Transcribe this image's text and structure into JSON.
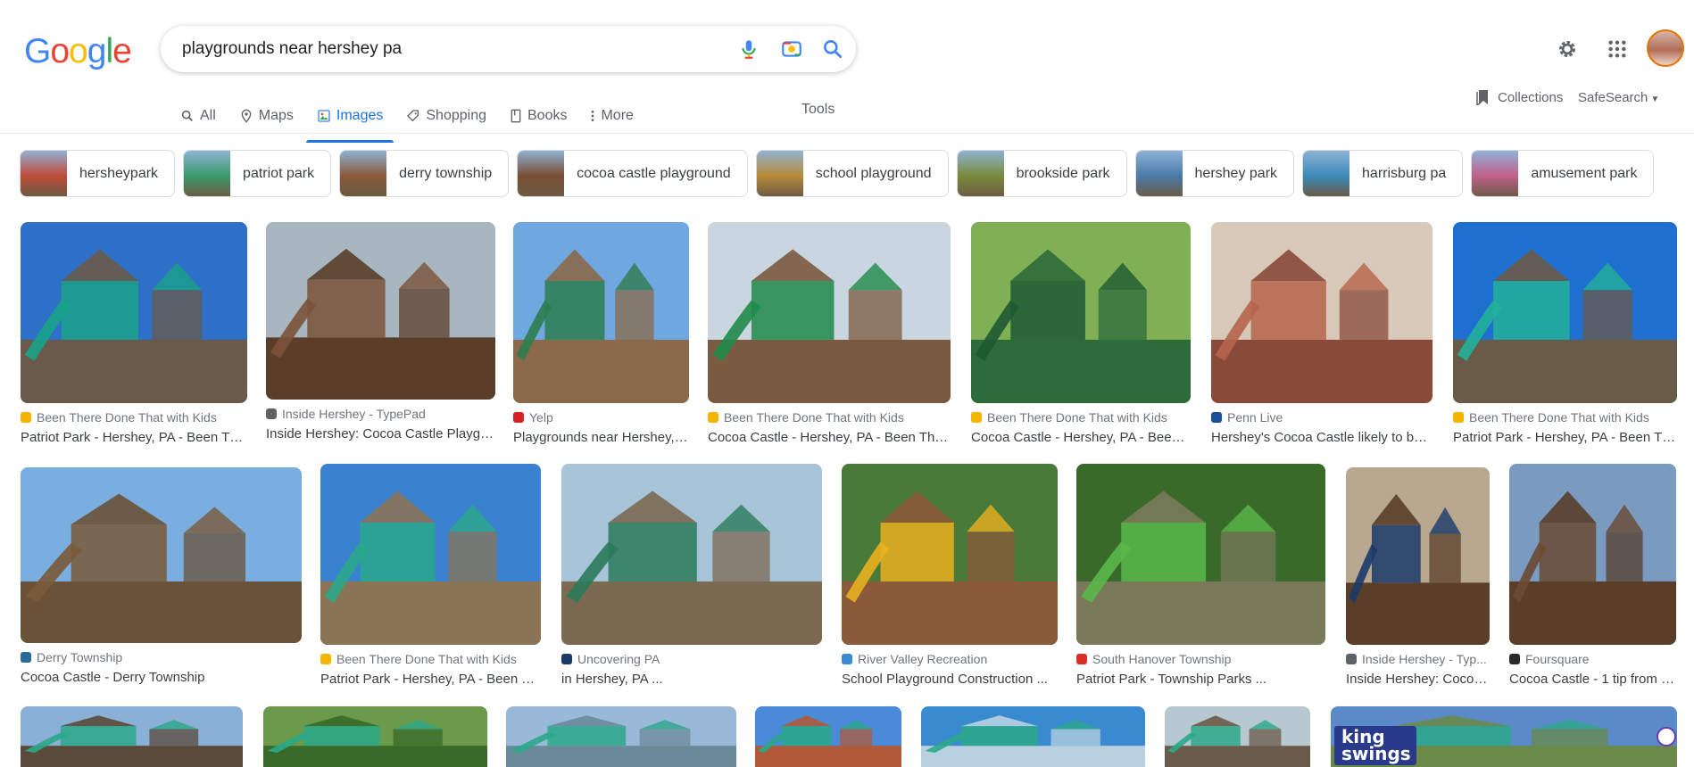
{
  "logo": {
    "letters": [
      "G",
      "o",
      "o",
      "g",
      "l",
      "e"
    ],
    "colors": [
      "#4285f4",
      "#ea4335",
      "#fbbc05",
      "#4285f4",
      "#34a853",
      "#ea4335"
    ]
  },
  "search": {
    "query": "playgrounds near hershey pa"
  },
  "icons": {
    "mic": "mic-icon",
    "lens": "camera-lens-icon",
    "search": "search-icon",
    "settings": "gear-icon",
    "apps": "apps-grid-icon"
  },
  "tabs": [
    {
      "label": "All",
      "icon": "search-icon"
    },
    {
      "label": "Maps",
      "icon": "map-pin-icon"
    },
    {
      "label": "Images",
      "icon": "image-icon",
      "active": true
    },
    {
      "label": "Shopping",
      "icon": "tag-icon"
    },
    {
      "label": "Books",
      "icon": "book-icon"
    },
    {
      "label": "More",
      "icon": "dots-vertical-icon"
    }
  ],
  "tools_label": "Tools",
  "collections_label": "Collections",
  "safesearch_label": "SafeSearch",
  "chips": [
    {
      "label": "hersheypark",
      "color": "#c04a3a"
    },
    {
      "label": "patriot park",
      "color": "#3a9a6a"
    },
    {
      "label": "derry township",
      "color": "#8a5a3a"
    },
    {
      "label": "cocoa castle playground",
      "color": "#7a4e32"
    },
    {
      "label": "school playground",
      "color": "#b98a3a"
    },
    {
      "label": "brookside park",
      "color": "#7a8a3a"
    },
    {
      "label": "hershey park",
      "color": "#4a7aa8"
    },
    {
      "label": "harrisburg pa",
      "color": "#3a8ab8"
    },
    {
      "label": "amusement park",
      "color": "#c0608a"
    }
  ],
  "results_row1": [
    {
      "source": "Been There Done That with Kids",
      "title": "Patriot Park - Hershey, PA - Been Ther...",
      "fav": "#f4b400",
      "sky": "#2e6fc7",
      "ground": "#6a5a4a",
      "accent": "#1aa38a"
    },
    {
      "source": "Inside Hershey - TypePad",
      "title": "Inside Hershey: Cocoa Castle Playgro...",
      "fav": "#5f6368",
      "sky": "#a8b6c0",
      "ground": "#5a3e2a",
      "accent": "#7a5238"
    },
    {
      "source": "Yelp",
      "title": "Playgrounds near Hershey, P...",
      "fav": "#d32323",
      "sky": "#6fa7e0",
      "ground": "#8a6a4a",
      "accent": "#2e7d4f"
    },
    {
      "source": "Been There Done That with Kids",
      "title": "Cocoa Castle - Hershey, PA - Been There ...",
      "fav": "#f4b400",
      "sky": "#c9d6e0",
      "ground": "#7a5a40",
      "accent": "#1f8a4a"
    },
    {
      "source": "Been There Done That with Kids",
      "title": "Cocoa Castle - Hershey, PA - Been T...",
      "fav": "#f4b400",
      "sky": "#7fb055",
      "ground": "#2e6b3a",
      "accent": "#1d5a32"
    },
    {
      "source": "Penn Live",
      "title": "Hershey's Cocoa Castle likely to be ...",
      "fav": "#1a4f9c",
      "sky": "#d8c8b8",
      "ground": "#8a4a3a",
      "accent": "#b5654a"
    },
    {
      "source": "Been There Done That with Kids",
      "title": "Patriot Park - Hershey, PA - Been The...",
      "fav": "#f4b400",
      "sky": "#1f6fd0",
      "ground": "#6a5a48",
      "accent": "#22b09a"
    }
  ],
  "results_row2": [
    {
      "source": "Derry Township",
      "title": "Cocoa Castle - Derry Township",
      "fav": "#2a6a9a",
      "sky": "#7aaee0",
      "ground": "#6a5238",
      "accent": "#7a5a3a"
    },
    {
      "source": "Been There Done That with Kids",
      "title": "Patriot Park - Hershey, PA - Been The...",
      "fav": "#f4b400",
      "sky": "#3a82d0",
      "ground": "#8a7456",
      "accent": "#2aa88a"
    },
    {
      "source": "Uncovering PA",
      "title": "in Hershey, PA ...",
      "fav": "#1a3a6a",
      "sky": "#a8c4d8",
      "ground": "#7a6a52",
      "accent": "#2a7a5a"
    },
    {
      "source": "River Valley Recreation",
      "title": "School Playground Construction ...",
      "fav": "#3a8ad0",
      "sky": "#4a7a3a",
      "ground": "#8a5a3a",
      "accent": "#e8b020"
    },
    {
      "source": "South Hanover Township",
      "title": "Patriot Park - Township Parks ...",
      "fav": "#d93025",
      "sky": "#3a6a2a",
      "ground": "#7a7a5a",
      "accent": "#5ab84a"
    },
    {
      "source": "Inside Hershey - Typ...",
      "title": "Inside Hershey: Cocoa ...",
      "fav": "#5f6368",
      "sky": "#b8a890",
      "ground": "#5a3e2a",
      "accent": "#1a3a6a"
    },
    {
      "source": "Foursquare",
      "title": "Cocoa Castle - 1 tip from 2...",
      "fav": "#2a2a2a",
      "sky": "#7a9ac0",
      "ground": "#5a3e2a",
      "accent": "#6a4a32"
    }
  ],
  "results_row3": [
    {
      "sky": "#8ab0d8",
      "ground": "#5a4a3a"
    },
    {
      "sky": "#6a9a4a",
      "ground": "#3a6a2a"
    },
    {
      "sky": "#9ab8d8",
      "ground": "#6a8a9a"
    },
    {
      "sky": "#4a8ad8",
      "ground": "#b05a3a"
    },
    {
      "sky": "#3a8ad0",
      "ground": "#b8d0e0"
    },
    {
      "sky": "#b8c8d0",
      "ground": "#6a5a4a"
    },
    {
      "sky": "#5a8ac8",
      "ground": "#6a8a4a",
      "badge": "king swings"
    }
  ]
}
